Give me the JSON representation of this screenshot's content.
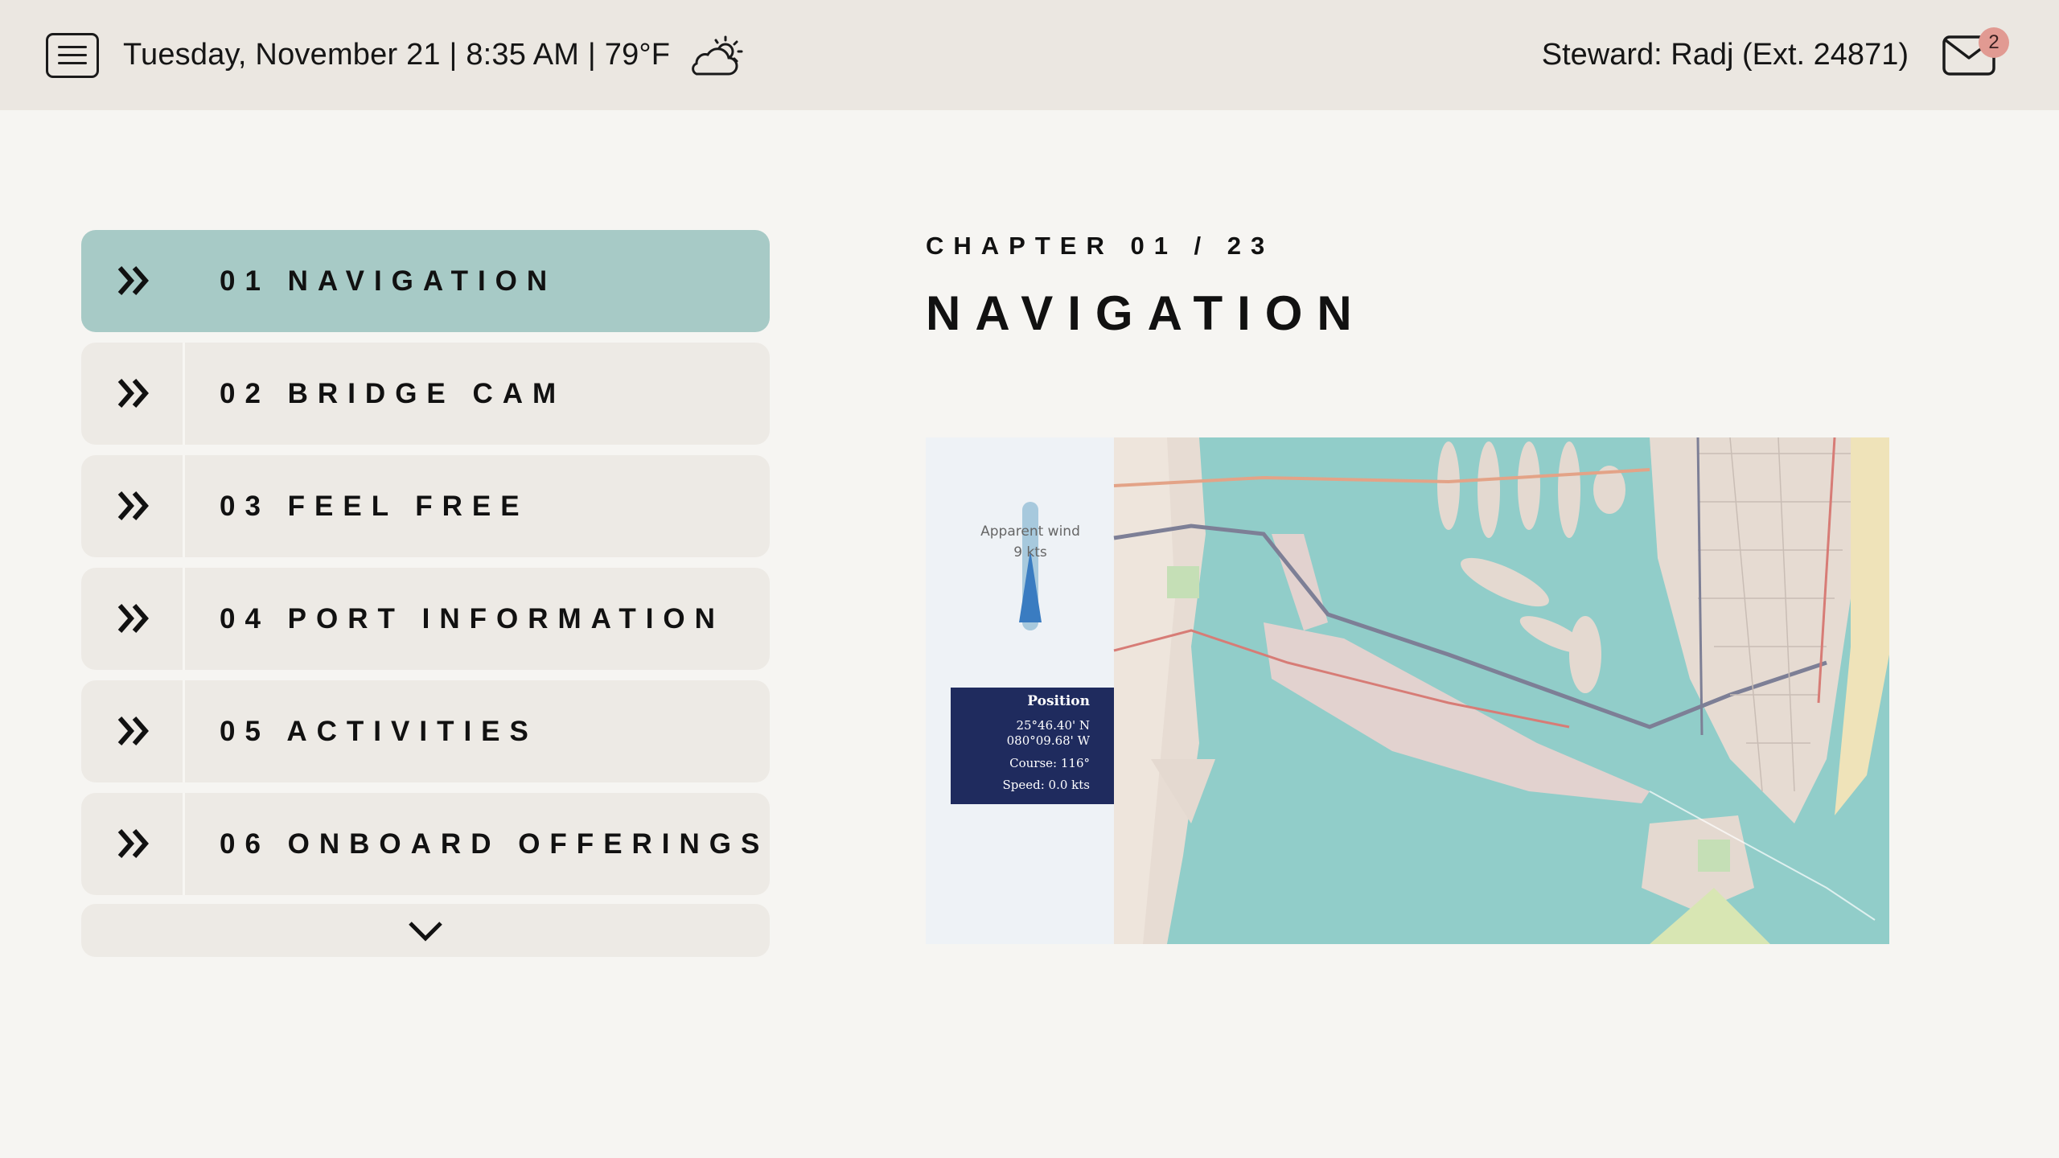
{
  "header": {
    "datetime": "Tuesday, November 21 | 8:35 AM | 79°F",
    "weather_icon": "partly-sunny-icon",
    "steward": "Steward: Radj (Ext. 24871)",
    "mail_count": "2"
  },
  "menu": {
    "items": [
      {
        "label": "01 NAVIGATION",
        "active": true
      },
      {
        "label": "02 BRIDGE CAM",
        "active": false
      },
      {
        "label": "03 FEEL FREE",
        "active": false
      },
      {
        "label": "04 PORT INFORMATION",
        "active": false
      },
      {
        "label": "05 ACTIVITIES",
        "active": false
      },
      {
        "label": "06 ONBOARD OFFERINGS",
        "active": false
      }
    ]
  },
  "chapter": {
    "eyebrow": "CHAPTER 01 / 23",
    "title": "NAVIGATION"
  },
  "map": {
    "wind_label": "Apparent wind",
    "wind_speed": "9 kts",
    "position_title": "Position",
    "latitude": "25°46.40' N",
    "longitude": "080°09.68' W",
    "course": "Course: 116°",
    "speed": "Speed: 0.0 kts"
  },
  "colors": {
    "accent": "#a7cac6",
    "menu_item_bg": "#edeae5",
    "topbar_bg": "#ebe7e1",
    "badge": "#e19a92",
    "water": "#91cdc9",
    "position_box": "#1f2b5e"
  }
}
